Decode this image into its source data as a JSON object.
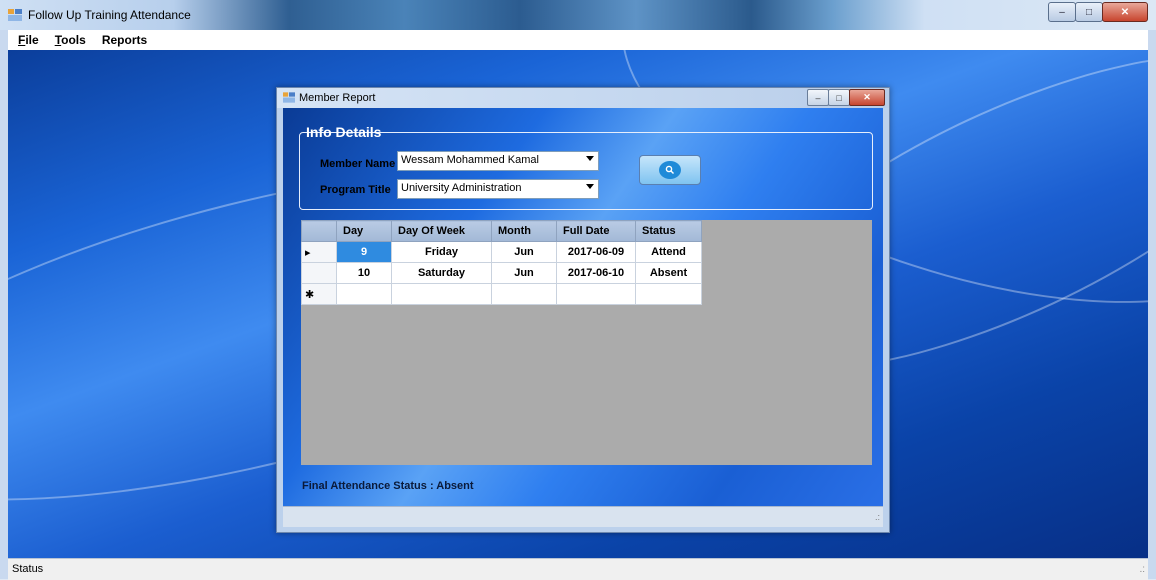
{
  "app": {
    "title": "Follow Up Training Attendance",
    "menu": [
      {
        "label": "File",
        "accel": "F",
        "rest": "ile"
      },
      {
        "label": "Tools",
        "accel": "T",
        "rest": "ools"
      },
      {
        "label": "Reports",
        "accel": "",
        "rest": "Reports"
      }
    ]
  },
  "status_bar": {
    "text": "Status"
  },
  "member_report": {
    "title": "Member Report",
    "group_title": "Info Details",
    "member_name_label": "Member Name",
    "member_name_value": "Wessam Mohammed Kamal",
    "program_title_label": "Program Title",
    "program_title_value": "University Administration",
    "grid": {
      "columns": [
        "Day",
        "Day Of Week",
        "Month",
        "Full Date",
        "Status"
      ],
      "rows": [
        {
          "day": "9",
          "day_of_week": "Friday",
          "month": "Jun",
          "full_date": "2017-06-09",
          "status": "Attend"
        },
        {
          "day": "10",
          "day_of_week": "Saturday",
          "month": "Jun",
          "full_date": "2017-06-10",
          "status": "Absent"
        }
      ]
    },
    "final_status": "Final Attendance Status : Absent"
  },
  "colors": {
    "mdi_background": "#1a64d6",
    "selected_cell": "#2f8be0",
    "grid_empty_area": "#ababab"
  },
  "icons": {
    "app": "form-app-icon",
    "search_button": "search-icon",
    "row_current": "row-pointer-icon",
    "row_new": "new-row-icon"
  }
}
